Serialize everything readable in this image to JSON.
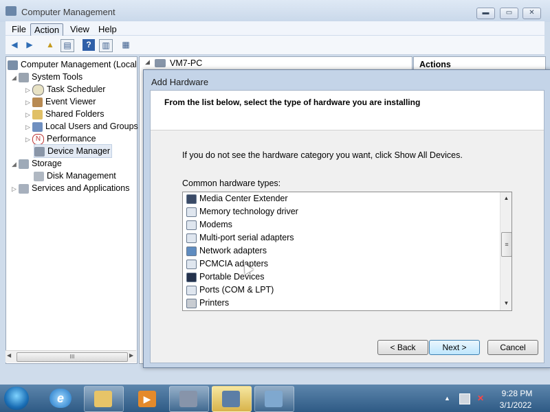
{
  "window": {
    "title": "Computer Management",
    "min_glyph": "▬",
    "max_glyph": "▭",
    "close_glyph": "✕"
  },
  "menu": {
    "file": "File",
    "action": "Action",
    "view": "View",
    "help": "Help"
  },
  "toolbar": {
    "back_icon": "back-arrow-icon",
    "forward_icon": "forward-arrow-icon",
    "up_icon": "up-folder-icon",
    "console_icon": "console-tree-icon",
    "help_icon": "help-icon",
    "action_pane_icon": "action-pane-icon",
    "properties_icon": "properties-icon"
  },
  "tree": {
    "root": "Computer Management (Local",
    "items": [
      {
        "label": "System Tools",
        "indent": 1
      },
      {
        "label": "Task Scheduler",
        "indent": 2
      },
      {
        "label": "Event Viewer",
        "indent": 2
      },
      {
        "label": "Shared Folders",
        "indent": 2
      },
      {
        "label": "Local Users and Groups",
        "indent": 2
      },
      {
        "label": "Performance",
        "indent": 2
      },
      {
        "label": "Device Manager",
        "indent": 2
      },
      {
        "label": "Storage",
        "indent": 1
      },
      {
        "label": "Disk Management",
        "indent": 2
      },
      {
        "label": "Services and Applications",
        "indent": 1
      }
    ],
    "hscroll_glyph": "III"
  },
  "middle": {
    "node": "VM7-PC"
  },
  "actions": {
    "title": "Actions"
  },
  "dialog": {
    "title": "Add Hardware",
    "heading": "From the list below, select the type of hardware you are installing",
    "info": "If you do not see the hardware category you want, click Show All Devices.",
    "list_label": "Common hardware types:",
    "items": [
      "Media Center Extender",
      "Memory technology driver",
      "Modems",
      "Multi-port serial adapters",
      "Network adapters",
      "PCMCIA adapters",
      "Portable Devices",
      "Ports (COM & LPT)",
      "Printers"
    ],
    "back": "< Back",
    "next": "Next >",
    "cancel": "Cancel"
  },
  "taskbar": {
    "time": "9:28 PM",
    "date": "3/1/2022"
  },
  "colors": {
    "titlebar": "#c9d8ea",
    "taskbar": "#2e5a85",
    "selection": "#e3eaf4",
    "next_border": "#3c7fb1"
  }
}
